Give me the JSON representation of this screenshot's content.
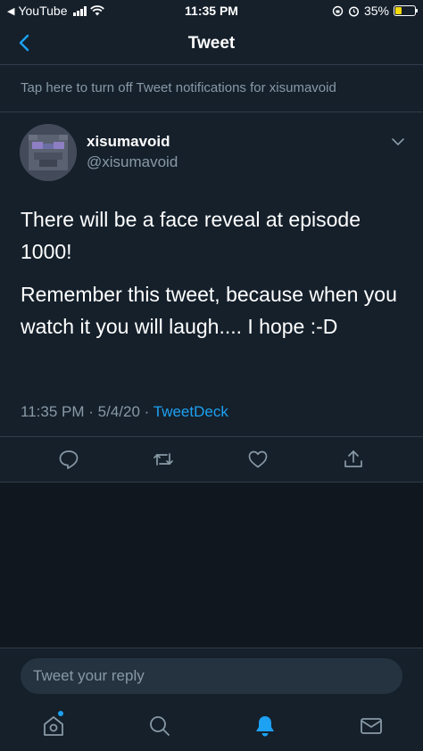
{
  "status_bar": {
    "back_app": "YouTube",
    "time": "11:35 PM",
    "battery_percent": "35%",
    "battery_level": 0.35,
    "icons": [
      "back-arrow-icon",
      "signal-icon",
      "wifi-icon",
      "rotation-lock-icon",
      "alarm-icon",
      "battery-icon"
    ]
  },
  "nav": {
    "title": "Tweet",
    "back_icon": "chevron-left-icon"
  },
  "notification_bar": {
    "text": "Tap here to turn off Tweet notifications for xisumavoid"
  },
  "tweet": {
    "author_name": "xisumavoid",
    "author_handle": "@xisumavoid",
    "paragraphs": [
      "There will be a face reveal at episode 1000!",
      "Remember this tweet, because when you watch it you will laugh.... I hope :-D"
    ],
    "time": "11:35 PM",
    "date": "5/4/20",
    "separator": "·",
    "source": "TweetDeck",
    "actions": [
      "reply-icon",
      "retweet-icon",
      "like-icon",
      "share-icon"
    ]
  },
  "reply": {
    "placeholder": "Tweet your reply"
  },
  "tabbar": {
    "tabs": [
      "home-icon",
      "search-icon",
      "notifications-icon",
      "messages-icon"
    ],
    "active": "notifications-icon"
  },
  "colors": {
    "background": "#15202b",
    "lower_background": "#10171e",
    "accent": "#1da1f2",
    "secondary_text": "#8899a6",
    "divider": "#2f3d4b"
  }
}
